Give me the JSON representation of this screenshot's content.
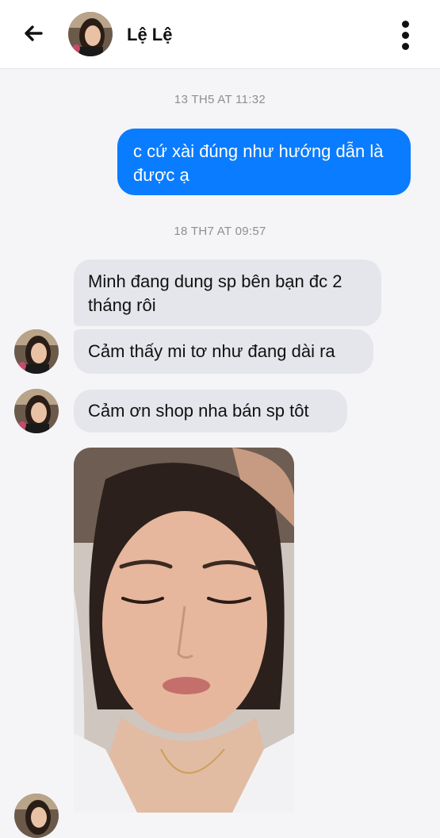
{
  "header": {
    "contact_name": "Lệ Lệ",
    "back_icon": "arrow-left-icon",
    "menu_icon": "more-vertical-icon"
  },
  "messages": {
    "timestamp_1": "13 TH5 AT 11:32",
    "outgoing_1": "c cứ xài đúng như hướng dẫn là được ạ",
    "timestamp_2": "18 TH7 AT 09:57",
    "incoming_1": "Minh đang dung sp bên bạn đc 2 tháng rôi",
    "incoming_2": "Cảm thấy mi tơ như đang dài ra",
    "incoming_3": "Cảm ơn shop nha bán sp tôt"
  },
  "colors": {
    "outgoing_bubble": "#0a7cff",
    "incoming_bubble": "#e4e6eb",
    "background": "#f5f5f7"
  }
}
